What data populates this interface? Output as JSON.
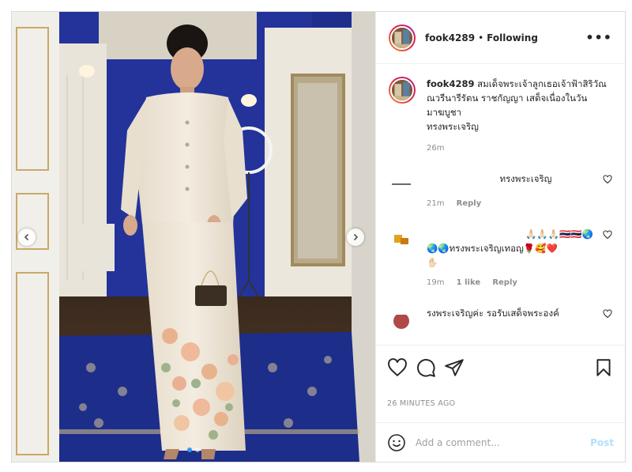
{
  "header": {
    "username": "fook4289",
    "separator": "•",
    "follow_status": "Following",
    "more_label": "•••"
  },
  "caption": {
    "username": "fook4289",
    "text": "สมเด็จพระเจ้าลูกเธอเจ้าฟ้าสิริวัณณวรีนารีรัตน ราชกัญญา เสด็จเนื่องในวันมาฆบูชา",
    "subtext": "ทรงพระเจริญ",
    "timestamp": "26m"
  },
  "comments": [
    {
      "text": "ทรงพระเจริญ",
      "timestamp": "21m",
      "likes": "",
      "reply": "Reply"
    },
    {
      "text_line1": "🙏🏻🙏🏻🙏🏻🇹🇭🇹🇭🌏",
      "text_line2": "🌏🌏ทรงพระเจริญเทอญ🌹🥰❤️",
      "text_line3": "✋🏻",
      "timestamp": "19m",
      "likes": "1 like",
      "reply": "Reply"
    },
    {
      "text": "รงพระเจริญค่ะ รอรับเสด็จพระองค์"
    }
  ],
  "footer": {
    "time_ago": "26 MINUTES AGO",
    "comment_placeholder": "Add a comment...",
    "post_label": "Post"
  },
  "carousel": {
    "dot_count": 2,
    "active_index": 0
  },
  "colors": {
    "link": "#3897f0",
    "post_button": "#b2dffc",
    "muted": "#8e8e8e"
  }
}
